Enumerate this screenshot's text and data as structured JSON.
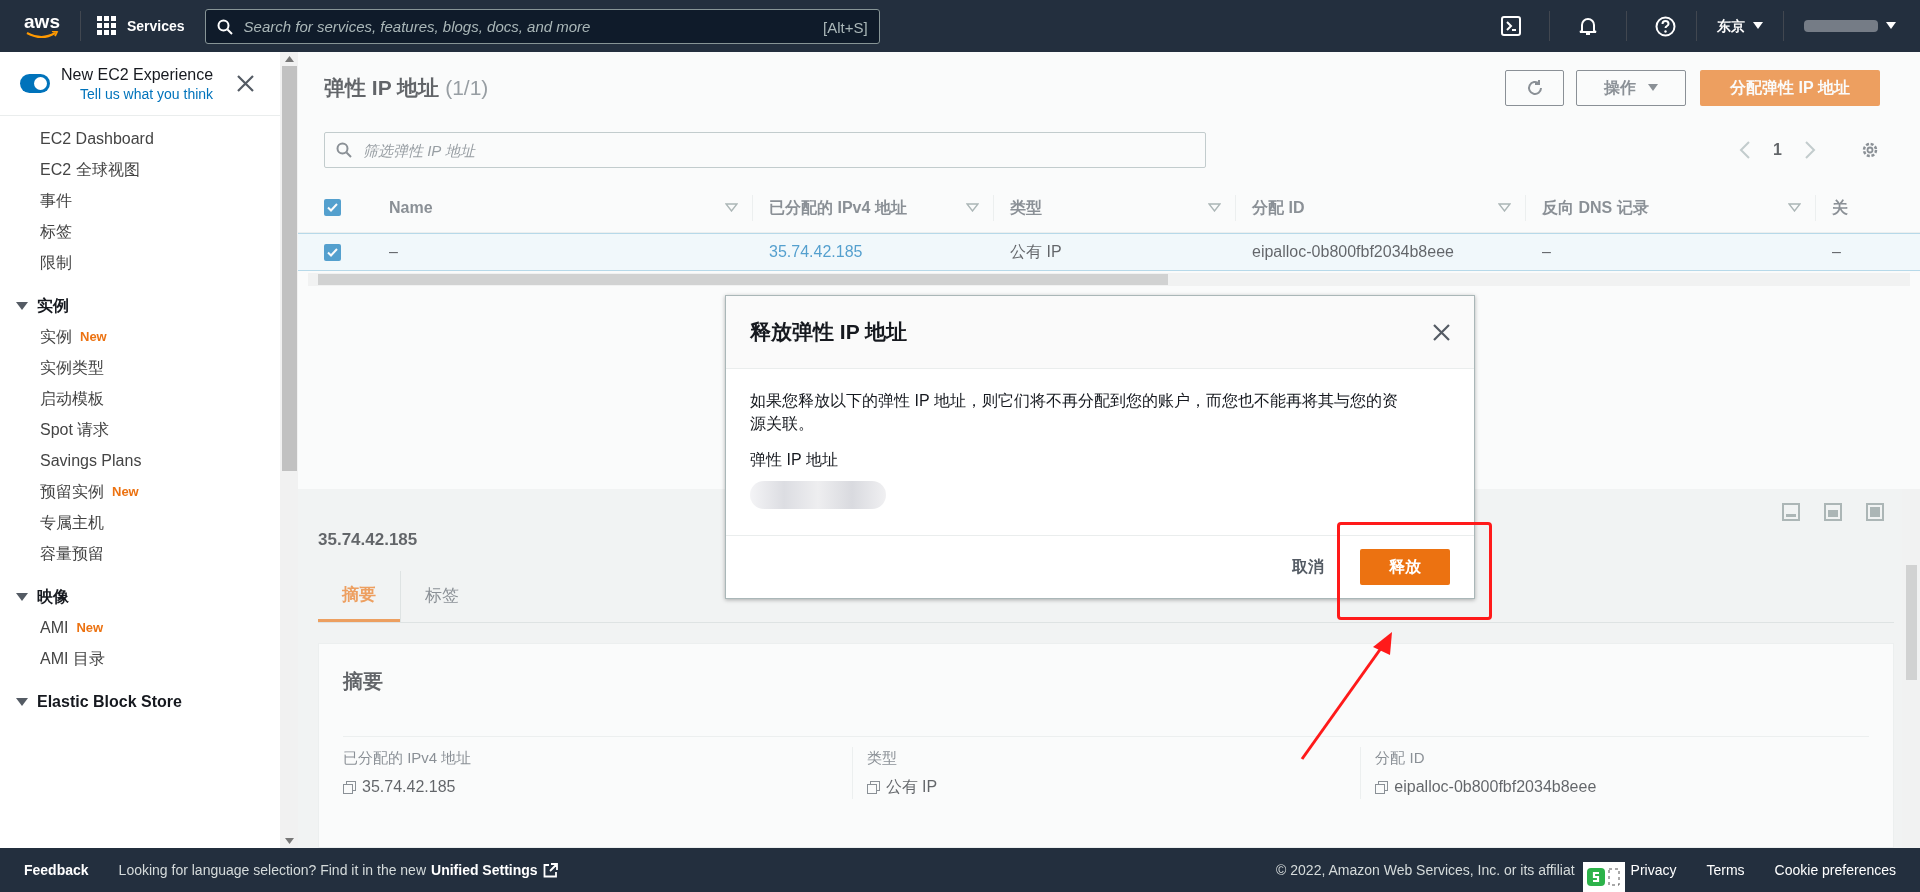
{
  "top_bar": {
    "logo": "aws",
    "services": "Services",
    "search": {
      "placeholder": "Search for services, features, blogs, docs, and more",
      "shortcut": "[Alt+S]"
    },
    "region": "东京"
  },
  "sidebar": {
    "experience_toggle": {
      "label": "New EC2 Experience",
      "link": "Tell us what you think",
      "on": true
    },
    "items": [
      {
        "label": "EC2 Dashboard"
      },
      {
        "label": "EC2 全球视图"
      },
      {
        "label": "事件"
      },
      {
        "label": "标签"
      },
      {
        "label": "限制"
      }
    ],
    "sections": [
      {
        "title": "实例",
        "expanded": true,
        "items": [
          {
            "label": "实例",
            "badge": "New"
          },
          {
            "label": "实例类型"
          },
          {
            "label": "启动模板"
          },
          {
            "label": "Spot 请求"
          },
          {
            "label": "Savings Plans"
          },
          {
            "label": "预留实例",
            "badge": "New"
          },
          {
            "label": "专属主机"
          },
          {
            "label": "容量预留"
          }
        ]
      },
      {
        "title": "映像",
        "expanded": true,
        "items": [
          {
            "label": "AMI",
            "badge": "New"
          },
          {
            "label": "AMI 目录"
          }
        ]
      },
      {
        "title": "Elastic Block Store",
        "expanded": true
      }
    ]
  },
  "table_panel": {
    "title": "弹性 IP 地址",
    "count": "(1/1)",
    "actions_button": "操作",
    "allocate_button": "分配弹性 IP 地址",
    "filter": {
      "placeholder": "筛选弹性 IP 地址"
    },
    "page": "1",
    "columns": [
      "Name",
      "已分配的 IPv4 地址",
      "类型",
      "分配 ID",
      "反向 DNS 记录",
      "关"
    ],
    "header_checked": true,
    "rows": [
      {
        "checked": true,
        "cells": [
          "–",
          "35.74.42.185",
          "公有 IP",
          "eipalloc-0b800fbf2034b8eee",
          "–",
          "–"
        ]
      }
    ]
  },
  "details_panel": {
    "title": "35.74.42.185",
    "tabs": [
      {
        "label": "摘要",
        "selected": true
      },
      {
        "label": "标签",
        "selected": false
      }
    ],
    "card_title": "摘要",
    "fields": [
      {
        "label": "已分配的 IPv4 地址",
        "value": "35.74.42.185"
      },
      {
        "label": "类型",
        "value": "公有 IP"
      },
      {
        "label": "分配 ID",
        "value": "eipalloc-0b800fbf2034b8eee"
      }
    ]
  },
  "dialog": {
    "title": "释放弹性 IP 地址",
    "message": "如果您释放以下的弹性 IP 地址，则它们将不再分配到您的账户，而您也不能再将其与您的资源关联。",
    "field_label": "弹性 IP 地址",
    "cancel": "取消",
    "confirm": "释放"
  },
  "footer": {
    "feedback": "Feedback",
    "language_note": "Looking for language selection? Find it in the new",
    "settings_link": "Unified Settings",
    "copyright": "© 2022, Amazon Web Services, Inc. or its affiliat",
    "links": [
      "Privacy",
      "Terms",
      "Cookie preferences"
    ]
  }
}
